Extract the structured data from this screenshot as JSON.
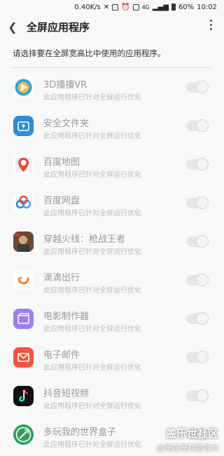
{
  "status_bar": {
    "speed": "0.40K/s",
    "network": "4G",
    "battery": "60%",
    "time": "10:02"
  },
  "app_bar": {
    "title": "全屏应用程序"
  },
  "description": "请选择要在全屏宽高比中使用的应用程序。",
  "apps": [
    {
      "name": "3D播播VR",
      "subtitle": "此应用程序已针对全屏运行优化",
      "icon": "3d-player-icon",
      "enabled": true
    },
    {
      "name": "安全文件夹",
      "subtitle": "此应用程序已针对全屏运行优化",
      "icon": "secure-folder-icon",
      "enabled": true
    },
    {
      "name": "百度地图",
      "subtitle": "此应用程序已针对全屏运行优化",
      "icon": "baidu-map-icon",
      "enabled": true
    },
    {
      "name": "百度网盘",
      "subtitle": "此应用程序已针对全屏运行优化",
      "icon": "baidu-netdisk-icon",
      "enabled": true
    },
    {
      "name": "穿越火线：枪战王者",
      "subtitle": "此应用程序已针对全屏运行优化",
      "icon": "crossfire-icon",
      "enabled": true
    },
    {
      "name": "滴滴出行",
      "subtitle": "此应用程序已针对全屏运行优化",
      "icon": "didi-icon",
      "enabled": true
    },
    {
      "name": "电影制作器",
      "subtitle": "此应用程序已针对全屏运行优化",
      "icon": "movie-maker-icon",
      "enabled": true
    },
    {
      "name": "电子邮件",
      "subtitle": "此应用程序已针对全屏运行优化",
      "icon": "email-icon",
      "enabled": true
    },
    {
      "name": "抖音短视频",
      "subtitle": "此应用程序已针对全屏运行优化",
      "icon": "douyin-icon",
      "enabled": true
    },
    {
      "name": "多玩我的世界盒子",
      "subtitle": "此应用程序已针对全屏运行优化",
      "icon": "minecraft-box-icon",
      "enabled": true
    }
  ],
  "watermark": {
    "line1": "盖乐世社区",
    "line2": "@俺在俺村是老大"
  },
  "colors": {
    "background": "#f8f8f8",
    "toggle_track": "#e6e6e6",
    "text_disabled": "#9a9a9a"
  }
}
